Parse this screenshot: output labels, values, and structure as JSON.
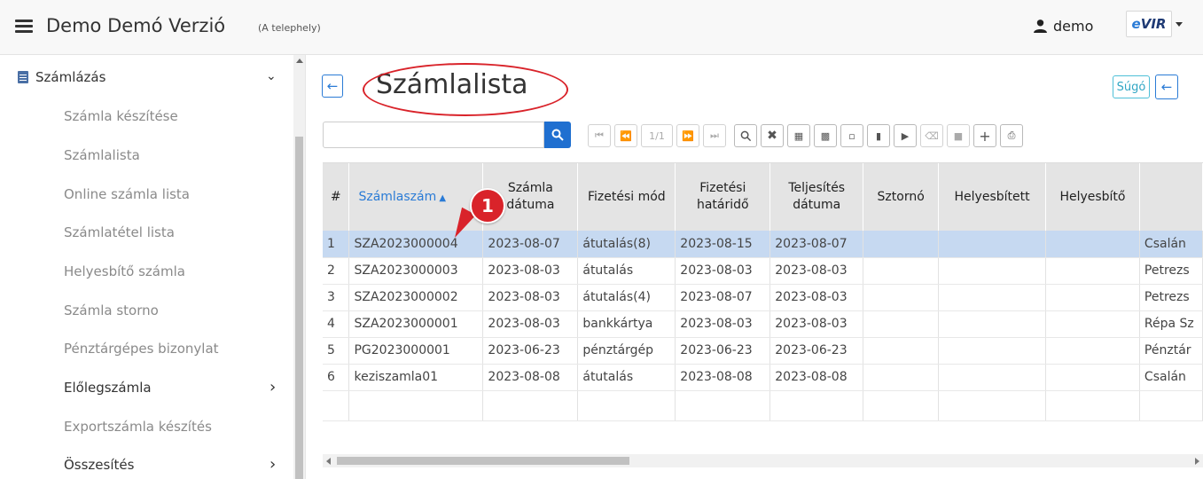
{
  "header": {
    "app_title": "Demo Demó Verzió",
    "app_subtitle": "(A telephely)",
    "user_name": "demo",
    "logo_text": "VIR"
  },
  "sidebar": {
    "section_title": "Számlázás",
    "items": [
      {
        "label": "Számla készítése"
      },
      {
        "label": "Számlalista"
      },
      {
        "label": "Online számla lista"
      },
      {
        "label": "Számlatétel lista"
      },
      {
        "label": "Helyesbítő számla"
      },
      {
        "label": "Számla storno"
      },
      {
        "label": "Pénztárgépes bizonylat"
      },
      {
        "label": "Előlegszámla"
      },
      {
        "label": "Exportszámla készítés"
      },
      {
        "label": "Összesítés"
      }
    ]
  },
  "main": {
    "title": "Számlalista",
    "help_label": "Súgó",
    "search_value": "",
    "pager_label": "1/1",
    "callout_number": "1"
  },
  "table": {
    "columns": [
      "#",
      "Számlaszám",
      "Számla dátuma",
      "Fizetési mód",
      "Fizetési határidő",
      "Teljesítés dátuma",
      "Sztornó",
      "Helyesbített",
      "Helyesbítő",
      ""
    ],
    "rows": [
      [
        "1",
        "SZA2023000004",
        "2023-08-07",
        "átutalás(8)",
        "2023-08-15",
        "2023-08-07",
        "",
        "",
        "",
        "Csalán"
      ],
      [
        "2",
        "SZA2023000003",
        "2023-08-03",
        "átutalás",
        "2023-08-03",
        "2023-08-03",
        "",
        "",
        "",
        "Petrezs"
      ],
      [
        "3",
        "SZA2023000002",
        "2023-08-03",
        "átutalás(4)",
        "2023-08-07",
        "2023-08-03",
        "",
        "",
        "",
        "Petrezs"
      ],
      [
        "4",
        "SZA2023000001",
        "2023-08-03",
        "bankkártya",
        "2023-08-03",
        "2023-08-03",
        "",
        "",
        "",
        "Répa Sz"
      ],
      [
        "5",
        "PG2023000001",
        "2023-06-23",
        "pénztárgép",
        "2023-06-23",
        "2023-06-23",
        "",
        "",
        "",
        "Pénztár"
      ],
      [
        "6",
        "keziszamla01",
        "2023-08-08",
        "átutalás",
        "2023-08-08",
        "2023-08-08",
        "",
        "",
        "",
        "Csalán"
      ]
    ]
  }
}
